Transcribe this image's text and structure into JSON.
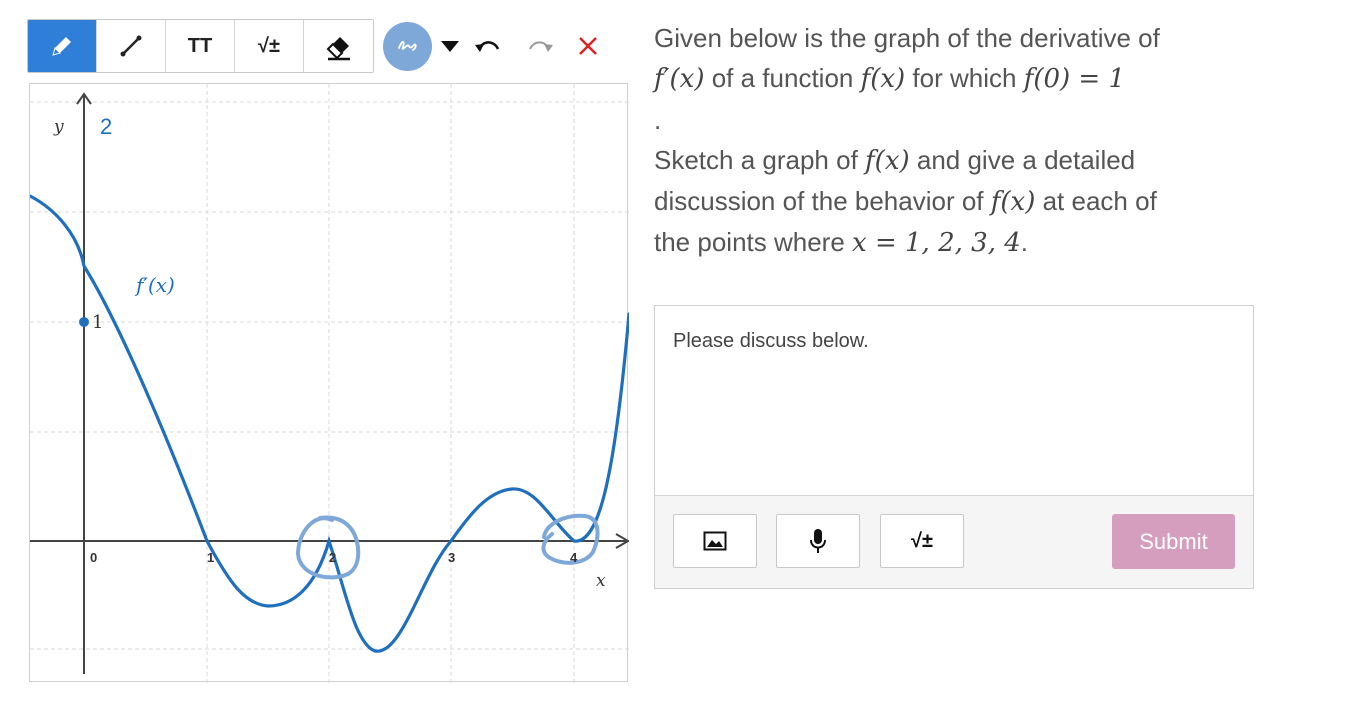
{
  "toolbar": {
    "tools": [
      {
        "name": "pencil-icon",
        "active": true
      },
      {
        "name": "line-icon",
        "active": false
      },
      {
        "name": "text-icon",
        "label": "TT",
        "active": false
      },
      {
        "name": "math-icon",
        "label": "√±",
        "active": false
      },
      {
        "name": "eraser-icon",
        "active": false
      }
    ],
    "color_button_icon": "scribble-icon",
    "color": "#7ea8d8",
    "undo_icon": "undo-icon",
    "redo_icon": "redo-icon",
    "clear_icon": "close-icon"
  },
  "graph": {
    "y_axis_label": "y",
    "x_axis_label": "x",
    "curve_label": "f′(x)",
    "y_tick_top": "2",
    "y_tick_one": "1",
    "x_ticks": [
      "0",
      "1",
      "2",
      "3",
      "4"
    ],
    "curve_color": "#1f6fbf",
    "annotation_color": "#7ea8d8"
  },
  "question": {
    "line1": "Given below is the graph of the derivative of",
    "line2_a": "f′(x)",
    "line2_b": "of a function",
    "line2_c": "f(x)",
    "line2_d": "for which",
    "line2_e": "f(0) = 1",
    "line3": ".",
    "line4_a": "Sketch a graph of",
    "line4_b": "f(x)",
    "line4_c": "and give a detailed",
    "line5_a": "discussion of the behavior of",
    "line5_b": "f(x)",
    "line5_c": "at each of",
    "line6_a": "the points where",
    "line6_b": "x = 1, 2, 3, 4",
    "line6_c": "."
  },
  "answer": {
    "placeholder": "Please discuss below.",
    "image_icon": "image-icon",
    "mic_icon": "microphone-icon",
    "math_label": "√±",
    "submit_label": "Submit",
    "submit_color": "#d69ebe"
  }
}
